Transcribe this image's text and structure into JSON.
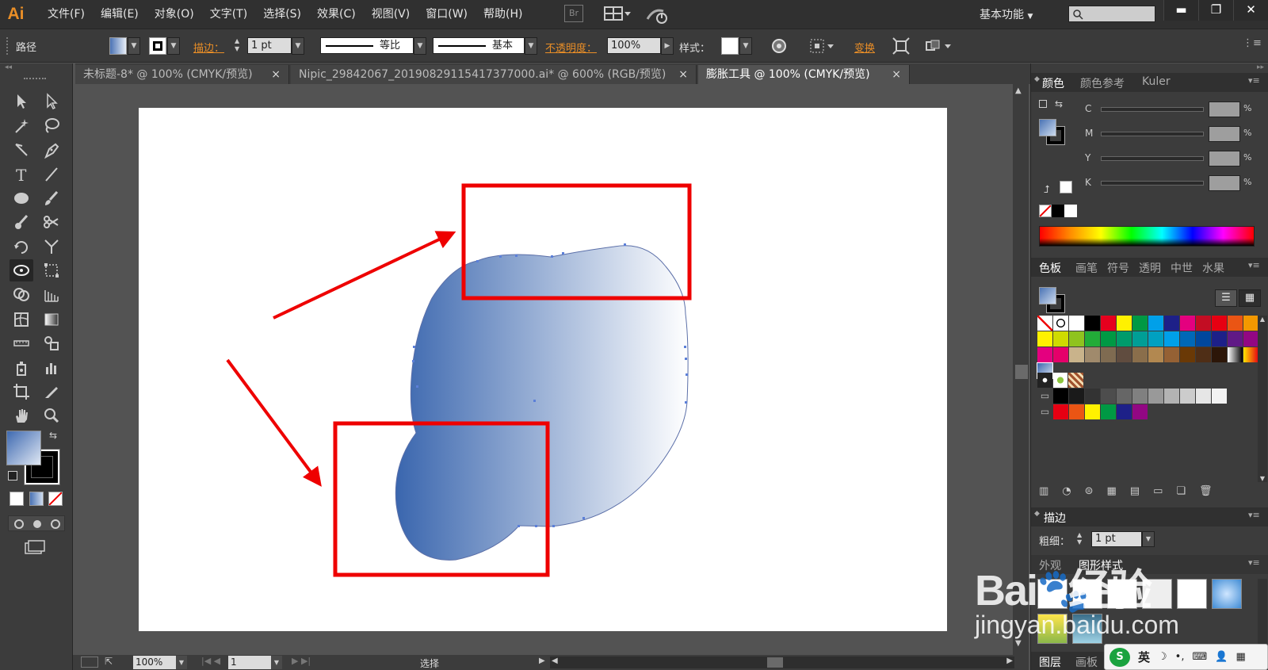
{
  "app": {
    "logo": "Ai",
    "workspace": "基本功能"
  },
  "menu": [
    "文件(F)",
    "编辑(E)",
    "对象(O)",
    "文字(T)",
    "选择(S)",
    "效果(C)",
    "视图(V)",
    "窗口(W)",
    "帮助(H)"
  ],
  "bridge_label": "Br",
  "control": {
    "selection_label": "路径",
    "stroke_label": "描边：",
    "stroke_weight": "1 pt",
    "profile_label": "等比",
    "brush_label": "基本",
    "opacity_label": "不透明度：",
    "opacity_value": "100%",
    "style_label": "样式：",
    "transform_label": "变换"
  },
  "tabs": [
    {
      "label": "未标题-8* @ 100% (CMYK/预览)",
      "active": false
    },
    {
      "label": "Nipic_29842067_20190829115417377000.ai* @ 600% (RGB/预览)",
      "active": false
    },
    {
      "label": "膨胀工具 @ 100% (CMYK/预览)",
      "active": true
    }
  ],
  "tab_close": "×",
  "color_panel": {
    "tabs": [
      "颜色",
      "颜色参考",
      "Kuler"
    ],
    "channels": [
      "C",
      "M",
      "Y",
      "K"
    ],
    "percent": "%"
  },
  "swatch_panel": {
    "tabs": [
      "色板",
      "画笔",
      "符号",
      "透明",
      "中世",
      "水果"
    ],
    "rows": [
      [
        "none",
        "reg",
        "#ffffff",
        "#000000",
        "#e6001e",
        "#fff100",
        "#009944",
        "#00a0e9",
        "#1d2088",
        "#e4007f",
        "#c30d23",
        "#e60012",
        "#ea5514",
        "#f39800"
      ],
      [
        "#fff100",
        "#cfdb00",
        "#8fc31f",
        "#22ac38",
        "#009944",
        "#009b6b",
        "#009e96",
        "#00a0c1",
        "#00a0e9",
        "#0068b7",
        "#00479d",
        "#1d2088",
        "#601986",
        "#920783"
      ],
      [
        "#e4007f",
        "#e5006a",
        "#c9b38b",
        "#a08a6c",
        "#7f6b51",
        "#604c3f",
        "#8a6e4b",
        "#b28850",
        "#956134",
        "#6a3906",
        "#4f2e16",
        "#2c1608",
        "#gradbw",
        "#gradyr"
      ],
      [
        "gradbl"
      ]
    ],
    "row4": [
      "pattern",
      "pattern",
      "pattern"
    ],
    "gray_row": [
      "#000000",
      "#1a1a1a",
      "#333333",
      "#4d4d4d",
      "#666666",
      "#808080",
      "#999999",
      "#b3b3b3",
      "#cccccc",
      "#e6e6e6",
      "#f2f2f2"
    ],
    "color_row": [
      "#e60012",
      "#ea5514",
      "#fff100",
      "#009944",
      "#1d2088",
      "#920783"
    ]
  },
  "stroke_panel": {
    "title": "描边",
    "weight_label": "粗细：",
    "weight_value": "1 pt"
  },
  "appearance_panel": {
    "tabs": [
      "外观",
      "图形样式"
    ]
  },
  "layers_panel": {
    "tabs": [
      "图层",
      "画板"
    ]
  },
  "status": {
    "zoom": "100%",
    "page": "1",
    "mode": "选择"
  },
  "watermark": {
    "brand": "Bai",
    "brand2": "经验",
    "url": "jingyan.baidu.com"
  },
  "ime": {
    "lang": "英"
  },
  "colors": {
    "accent_orange": "#e98e27",
    "highlight_red": "#ee0000",
    "gradient_start": "#3a66ae",
    "gradient_end": "#ffffff"
  }
}
